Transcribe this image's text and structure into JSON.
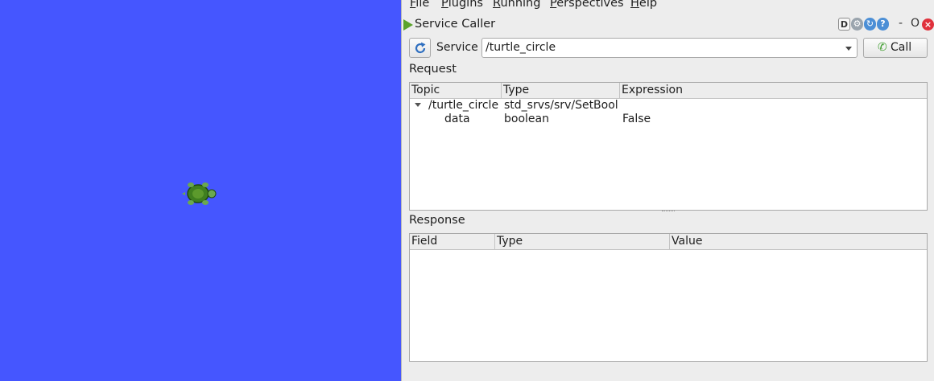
{
  "menubar": {
    "items": [
      {
        "label_first": "F",
        "label_rest": "ile"
      },
      {
        "label_first": "P",
        "label_rest": "lugins"
      },
      {
        "label_first": "R",
        "label_rest": "unning"
      },
      {
        "label_first": "P",
        "label_rest": "erspectives"
      },
      {
        "label_first": "H",
        "label_rest": "elp"
      }
    ]
  },
  "plugin": {
    "title": "Service Caller",
    "titlebar_buttons": {
      "d": "D",
      "min": "-",
      "restore": "O",
      "close": "×"
    }
  },
  "service": {
    "label": "Service",
    "selected": "/turtle_circle",
    "call_label": "Call"
  },
  "request": {
    "label": "Request",
    "columns": [
      "Topic",
      "Type",
      "Expression"
    ],
    "rows": [
      {
        "topic": "/turtle_circle",
        "type": "std_srvs/srv/SetBool",
        "expression": ""
      },
      {
        "topic": "data",
        "type": "boolean",
        "expression": "False"
      }
    ]
  },
  "response": {
    "label": "Response",
    "columns": [
      "Field",
      "Type",
      "Value"
    ]
  },
  "icons": {
    "play": "play-icon",
    "refresh": "refresh-icon",
    "phone": "phone-icon",
    "turtle": "turtle-icon"
  },
  "colors": {
    "sim_background": "#4556ff",
    "turtle_green": "#3f7f1f"
  }
}
